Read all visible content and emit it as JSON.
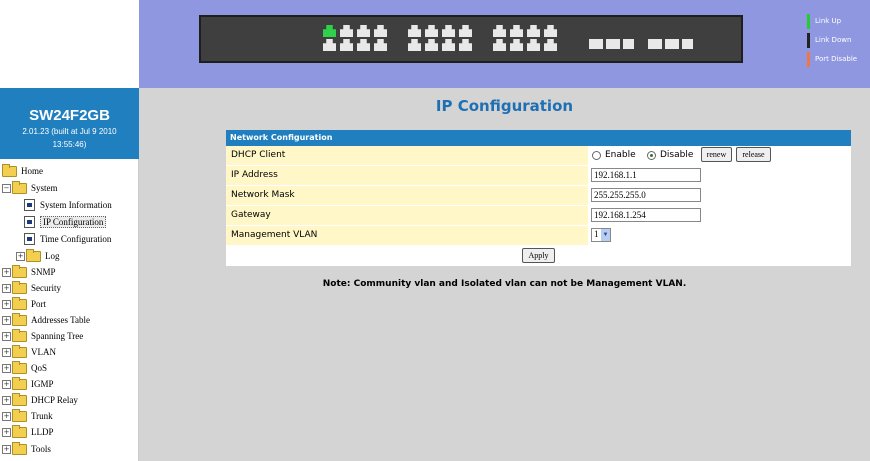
{
  "banner": {
    "legend": [
      {
        "label": "Link Up",
        "color": "#22cc33"
      },
      {
        "label": "Link Down",
        "color": "#222222"
      },
      {
        "label": "Port Disable",
        "color": "#ee7744"
      }
    ]
  },
  "brand": {
    "model": "SW24F2GB",
    "version_line1": "2.01.23 (built at Jul 9 2010",
    "version_line2": "13:55:46)"
  },
  "tree": {
    "home": "Home",
    "system": "System",
    "system_info": "System Information",
    "ip_config": "IP Configuration",
    "time_config": "Time Configuration",
    "log": "Log",
    "snmp": "SNMP",
    "security": "Security",
    "port": "Port",
    "address_table": "Addresses Table",
    "spanning_tree": "Spanning Tree",
    "vlan": "VLAN",
    "qos": "QoS",
    "igmp": "IGMP",
    "dhcp_relay": "DHCP Relay",
    "trunk": "Trunk",
    "lldp": "LLDP",
    "tools": "Tools"
  },
  "main": {
    "title": "IP Configuration",
    "panel_title": "Network Configuration",
    "dhcp_label": "DHCP Client",
    "enable_label": "Enable",
    "disable_label": "Disable",
    "dhcp_mode": "Disable",
    "renew_label": "renew",
    "release_label": "release",
    "ip_label": "IP Address",
    "ip_value": "192.168.1.1",
    "mask_label": "Network Mask",
    "mask_value": "255.255.255.0",
    "gateway_label": "Gateway",
    "gateway_value": "192.168.1.254",
    "vlan_label": "Management VLAN",
    "vlan_value": "1",
    "apply_label": "Apply",
    "note": "Note: Community vlan and Isolated vlan can not be Management VLAN."
  }
}
